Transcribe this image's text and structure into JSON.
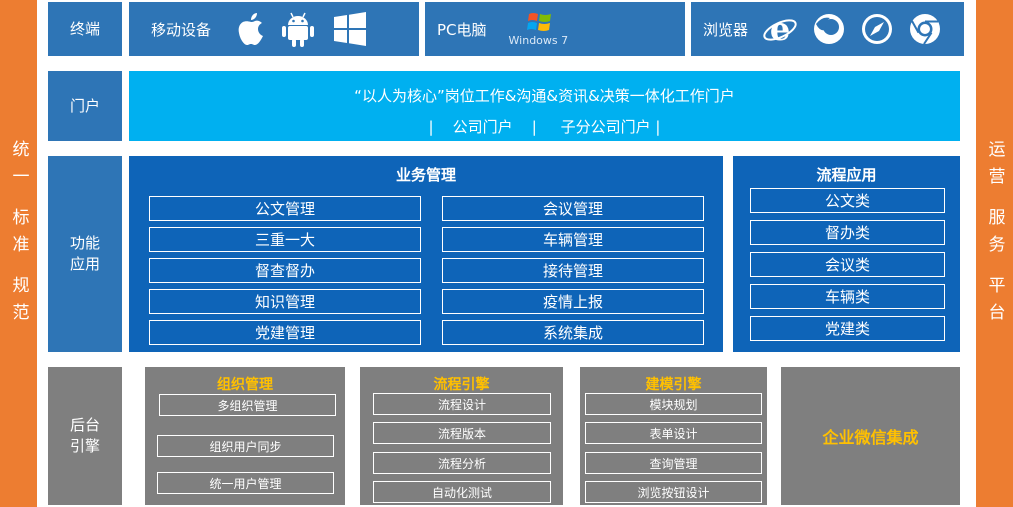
{
  "left_bar": {
    "text1": "统一",
    "text2": "标准",
    "text3": "规范"
  },
  "right_bar": {
    "text1": "运营",
    "text2": "服务",
    "text3": "平台"
  },
  "terminal": {
    "label": "终端",
    "mobile": {
      "label": "移动设备",
      "icons": [
        "apple-icon",
        "android-icon",
        "windows-icon"
      ]
    },
    "pc": {
      "label": "PC电脑",
      "windows_text": "Windows 7"
    },
    "browser": {
      "label": "浏览器",
      "icons": [
        "ie-icon",
        "firefox-icon",
        "safari-icon",
        "chrome-icon"
      ]
    }
  },
  "portal": {
    "label": "门户",
    "line1": "“以人为核心”岗位工作&沟通&资讯&决策一体化工作门户",
    "line2": "|    公司门户    |     子分公司门户 |"
  },
  "function": {
    "label1": "功能",
    "label2": "应用",
    "business": {
      "title": "业务管理",
      "left": [
        "公文管理",
        "三重一大",
        "督查督办",
        "知识管理",
        "党建管理"
      ],
      "right": [
        "会议管理",
        "车辆管理",
        "接待管理",
        "疫情上报",
        "系统集成"
      ]
    },
    "process": {
      "title": "流程应用",
      "items": [
        "公文类",
        "督办类",
        "会议类",
        "车辆类",
        "党建类"
      ]
    }
  },
  "engine": {
    "label1": "后台",
    "label2": "引擎",
    "org": {
      "title": "组织管理",
      "items": [
        "多组织管理",
        "组织用户同步",
        "统一用户管理"
      ]
    },
    "flow": {
      "title": "流程引擎",
      "items": [
        "流程设计",
        "流程版本",
        "流程分析",
        "自动化测试"
      ]
    },
    "model": {
      "title": "建模引擎",
      "items": [
        "模块规划",
        "表单设计",
        "查询管理",
        "浏览按钮设计"
      ]
    },
    "wechat": {
      "title": "企业微信集成"
    }
  },
  "colors": {
    "orange": "#ed7d31",
    "blue": "#2e75b6",
    "dark_blue": "#0e64b8",
    "cyan": "#00b0f0",
    "gray": "#7f7f7f",
    "gold": "#ffc000"
  }
}
